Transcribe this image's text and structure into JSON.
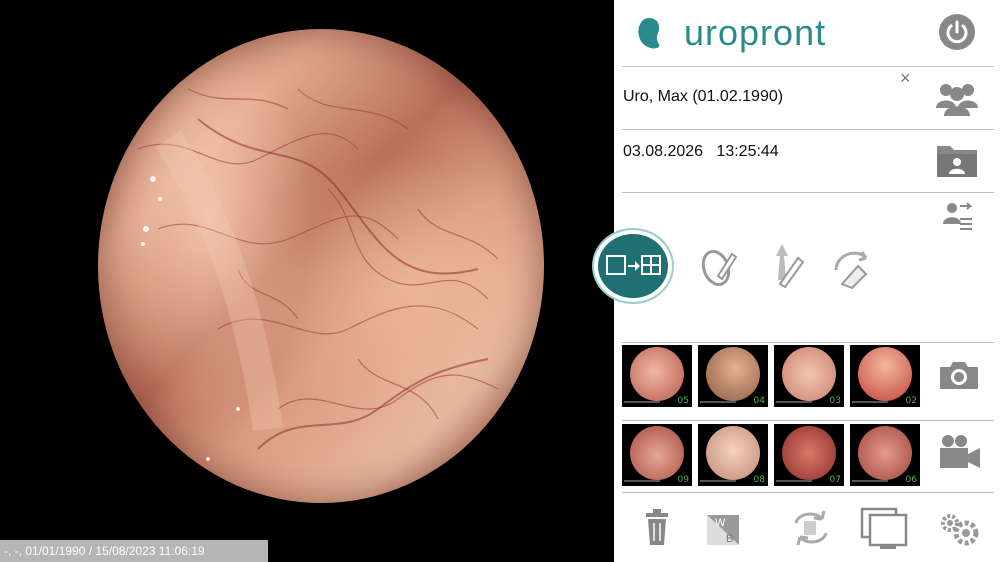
{
  "video": {
    "status_text": "-, -, 01/01/1990  / 15/08/2023  11:06:19"
  },
  "header": {
    "logo_text": "uropront",
    "brand_color": "#2a8a8e"
  },
  "patient": {
    "name": "Uro, Max (01.02.1990)",
    "close_symbol": "×"
  },
  "session": {
    "date": "03.08.2026",
    "time": "13:25:44"
  },
  "icons": {
    "power": "power-icon",
    "patients": "patients-icon",
    "patient_folder": "patient-folder-icon",
    "transfer": "user-transfer-icon",
    "layout_switch": "layout-switch-icon",
    "annotate": "annotate-icon",
    "arrow_tool": "arrow-pencil-icon",
    "eraser": "eraser-icon",
    "camera": "camera-icon",
    "video_camera": "video-camera-icon",
    "trash": "trash-icon",
    "white_balance": "white-balance-icon",
    "swap": "swap-icon",
    "screens": "screens-icon",
    "settings": "settings-icon"
  },
  "image_thumbnails": [
    {
      "label": "05"
    },
    {
      "label": "04"
    },
    {
      "label": "03"
    },
    {
      "label": "02"
    }
  ],
  "video_thumbnails": [
    {
      "label": "09"
    },
    {
      "label": "08"
    },
    {
      "label": "07"
    },
    {
      "label": "06"
    }
  ],
  "white_balance": {
    "w": "W",
    "b": "B"
  }
}
